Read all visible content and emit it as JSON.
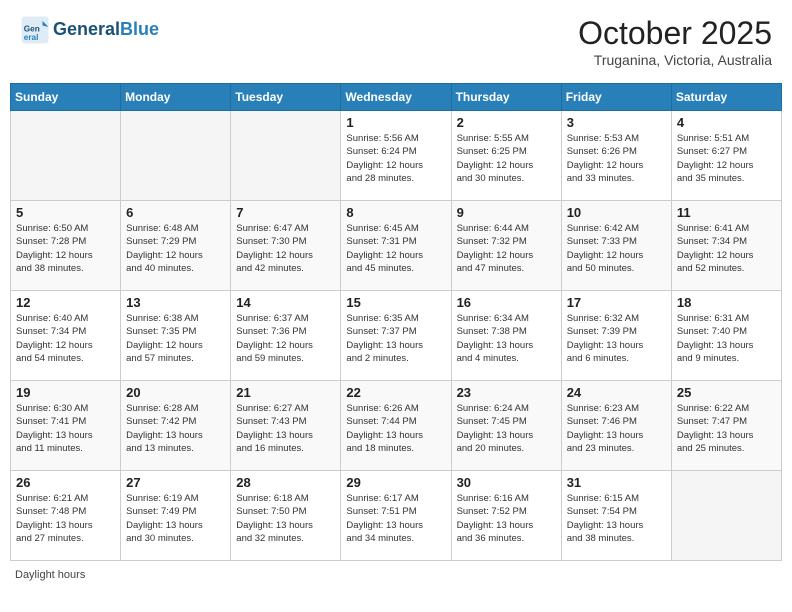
{
  "header": {
    "logo_line1": "General",
    "logo_line2": "Blue",
    "month": "October 2025",
    "location": "Truganina, Victoria, Australia"
  },
  "days_of_week": [
    "Sunday",
    "Monday",
    "Tuesday",
    "Wednesday",
    "Thursday",
    "Friday",
    "Saturday"
  ],
  "weeks": [
    [
      {
        "day": "",
        "info": ""
      },
      {
        "day": "",
        "info": ""
      },
      {
        "day": "",
        "info": ""
      },
      {
        "day": "1",
        "info": "Sunrise: 5:56 AM\nSunset: 6:24 PM\nDaylight: 12 hours\nand 28 minutes."
      },
      {
        "day": "2",
        "info": "Sunrise: 5:55 AM\nSunset: 6:25 PM\nDaylight: 12 hours\nand 30 minutes."
      },
      {
        "day": "3",
        "info": "Sunrise: 5:53 AM\nSunset: 6:26 PM\nDaylight: 12 hours\nand 33 minutes."
      },
      {
        "day": "4",
        "info": "Sunrise: 5:51 AM\nSunset: 6:27 PM\nDaylight: 12 hours\nand 35 minutes."
      }
    ],
    [
      {
        "day": "5",
        "info": "Sunrise: 6:50 AM\nSunset: 7:28 PM\nDaylight: 12 hours\nand 38 minutes."
      },
      {
        "day": "6",
        "info": "Sunrise: 6:48 AM\nSunset: 7:29 PM\nDaylight: 12 hours\nand 40 minutes."
      },
      {
        "day": "7",
        "info": "Sunrise: 6:47 AM\nSunset: 7:30 PM\nDaylight: 12 hours\nand 42 minutes."
      },
      {
        "day": "8",
        "info": "Sunrise: 6:45 AM\nSunset: 7:31 PM\nDaylight: 12 hours\nand 45 minutes."
      },
      {
        "day": "9",
        "info": "Sunrise: 6:44 AM\nSunset: 7:32 PM\nDaylight: 12 hours\nand 47 minutes."
      },
      {
        "day": "10",
        "info": "Sunrise: 6:42 AM\nSunset: 7:33 PM\nDaylight: 12 hours\nand 50 minutes."
      },
      {
        "day": "11",
        "info": "Sunrise: 6:41 AM\nSunset: 7:34 PM\nDaylight: 12 hours\nand 52 minutes."
      }
    ],
    [
      {
        "day": "12",
        "info": "Sunrise: 6:40 AM\nSunset: 7:34 PM\nDaylight: 12 hours\nand 54 minutes."
      },
      {
        "day": "13",
        "info": "Sunrise: 6:38 AM\nSunset: 7:35 PM\nDaylight: 12 hours\nand 57 minutes."
      },
      {
        "day": "14",
        "info": "Sunrise: 6:37 AM\nSunset: 7:36 PM\nDaylight: 12 hours\nand 59 minutes."
      },
      {
        "day": "15",
        "info": "Sunrise: 6:35 AM\nSunset: 7:37 PM\nDaylight: 13 hours\nand 2 minutes."
      },
      {
        "day": "16",
        "info": "Sunrise: 6:34 AM\nSunset: 7:38 PM\nDaylight: 13 hours\nand 4 minutes."
      },
      {
        "day": "17",
        "info": "Sunrise: 6:32 AM\nSunset: 7:39 PM\nDaylight: 13 hours\nand 6 minutes."
      },
      {
        "day": "18",
        "info": "Sunrise: 6:31 AM\nSunset: 7:40 PM\nDaylight: 13 hours\nand 9 minutes."
      }
    ],
    [
      {
        "day": "19",
        "info": "Sunrise: 6:30 AM\nSunset: 7:41 PM\nDaylight: 13 hours\nand 11 minutes."
      },
      {
        "day": "20",
        "info": "Sunrise: 6:28 AM\nSunset: 7:42 PM\nDaylight: 13 hours\nand 13 minutes."
      },
      {
        "day": "21",
        "info": "Sunrise: 6:27 AM\nSunset: 7:43 PM\nDaylight: 13 hours\nand 16 minutes."
      },
      {
        "day": "22",
        "info": "Sunrise: 6:26 AM\nSunset: 7:44 PM\nDaylight: 13 hours\nand 18 minutes."
      },
      {
        "day": "23",
        "info": "Sunrise: 6:24 AM\nSunset: 7:45 PM\nDaylight: 13 hours\nand 20 minutes."
      },
      {
        "day": "24",
        "info": "Sunrise: 6:23 AM\nSunset: 7:46 PM\nDaylight: 13 hours\nand 23 minutes."
      },
      {
        "day": "25",
        "info": "Sunrise: 6:22 AM\nSunset: 7:47 PM\nDaylight: 13 hours\nand 25 minutes."
      }
    ],
    [
      {
        "day": "26",
        "info": "Sunrise: 6:21 AM\nSunset: 7:48 PM\nDaylight: 13 hours\nand 27 minutes."
      },
      {
        "day": "27",
        "info": "Sunrise: 6:19 AM\nSunset: 7:49 PM\nDaylight: 13 hours\nand 30 minutes."
      },
      {
        "day": "28",
        "info": "Sunrise: 6:18 AM\nSunset: 7:50 PM\nDaylight: 13 hours\nand 32 minutes."
      },
      {
        "day": "29",
        "info": "Sunrise: 6:17 AM\nSunset: 7:51 PM\nDaylight: 13 hours\nand 34 minutes."
      },
      {
        "day": "30",
        "info": "Sunrise: 6:16 AM\nSunset: 7:52 PM\nDaylight: 13 hours\nand 36 minutes."
      },
      {
        "day": "31",
        "info": "Sunrise: 6:15 AM\nSunset: 7:54 PM\nDaylight: 13 hours\nand 38 minutes."
      },
      {
        "day": "",
        "info": ""
      }
    ]
  ],
  "footer": {
    "daylight_label": "Daylight hours"
  }
}
